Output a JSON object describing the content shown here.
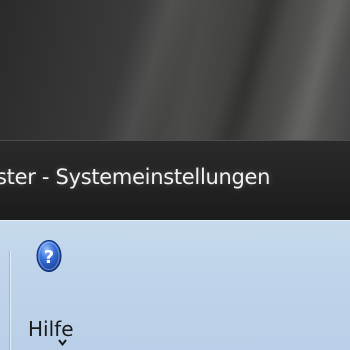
{
  "window": {
    "title": "ster - Systemeinstellungen"
  },
  "toolbar": {
    "help_label": "Hilfe",
    "help_icon": "help-question-icon",
    "dropdown_icon": "chevron-down-icon"
  },
  "colors": {
    "titlebar": "#242424",
    "toolbar": "#c2d7ec",
    "help_icon": "#2f63c8"
  }
}
